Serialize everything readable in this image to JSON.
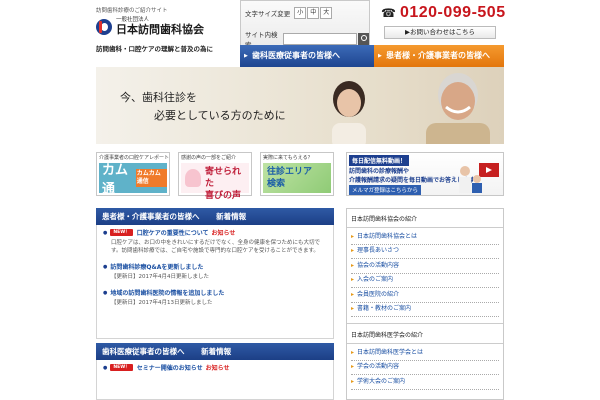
{
  "header": {
    "topline": "訪問歯科診療のご紹介サイト",
    "logo_small": "一般社団法人",
    "logo_main": "日本訪問歯科協会",
    "tagline": "訪問歯科・口腔ケアの理解と普及の為に",
    "font_size_label": "文字サイズ変更",
    "font_sizes": [
      "小",
      "中",
      "大"
    ],
    "search_label": "サイト内検索",
    "search_placeholder": "",
    "phone_icon": "☎",
    "phone_number": "0120-099-505",
    "contact_label": "▶お問い合わせはこちら"
  },
  "nav": {
    "medical": "歯科医療従事者の皆様へ",
    "patients": "患者様・介護事業者の皆様へ"
  },
  "hero": {
    "line1": "今、歯科往診を",
    "line2": "必要としている方のために"
  },
  "banners": {
    "b1_caption": "介護事業者の口腔ケアレポート",
    "b1_big": "カム通",
    "b1_sub": "カムカム通信",
    "b2_caption": "感謝の声の一部をご紹介",
    "b2_big_l1": "寄せられた",
    "b2_big_l2": "喜びの声",
    "b3_caption": "実際に来てもらえる？",
    "b3_big_l1": "往診エリア",
    "b3_big_l2": "検索",
    "b4_top": "毎日配信無料動画！",
    "b4_l1": "訪問歯科の診療報酬や",
    "b4_l2": "介護報酬請求の疑問を毎日動画でお答えします！",
    "b4_btn": "メルマガ登録はこちらから"
  },
  "news_patients": {
    "title": "患者様・介護事業者の皆様へ",
    "subtitle": "新着情報",
    "items": [
      {
        "badge": "NEW！",
        "title": "口腔ケアの重要性について",
        "title_tag": "お知らせ",
        "body": "口腔ケアは、お口の中をきれいにするだけでなく、全身の健康を保つためにも大切です。訪問歯科診療では、ご自宅や施設で専門的な口腔ケアを受けることができます。"
      },
      {
        "badge": "",
        "title": "訪問歯科診療Q&Aを更新しました",
        "title_tag": "",
        "body": "【更新日】2017年4月4日更新しました"
      },
      {
        "badge": "",
        "title": "地域の訪問歯科医院の情報を追加しました",
        "title_tag": "",
        "body": "【更新日】2017年4月13日更新しました"
      }
    ]
  },
  "news_medical": {
    "title": "歯科医療従事者の皆様へ",
    "subtitle": "新着情報",
    "items": [
      {
        "badge": "NEW！",
        "title": "セミナー開催のお知らせ",
        "title_tag": "お知らせ"
      }
    ]
  },
  "sidebar": {
    "head1": "日本訪問歯科協会の紹介",
    "group1": [
      "日本訪問歯科協会とは",
      "理事長あいさつ",
      "協会の活動内容",
      "入会のご案内",
      "会員医院の紹介",
      "書籍・教材のご案内"
    ],
    "head2": "日本訪問歯科医学会の紹介",
    "group2": [
      "日本訪問歯科医学会とは",
      "学会の活動内容",
      "学術大会のご案内"
    ]
  },
  "colors": {
    "brand_blue": "#1d3f8f",
    "accent_orange": "#e3760c",
    "phone_red": "#c8161d",
    "new_badge": "#d81f1f"
  }
}
